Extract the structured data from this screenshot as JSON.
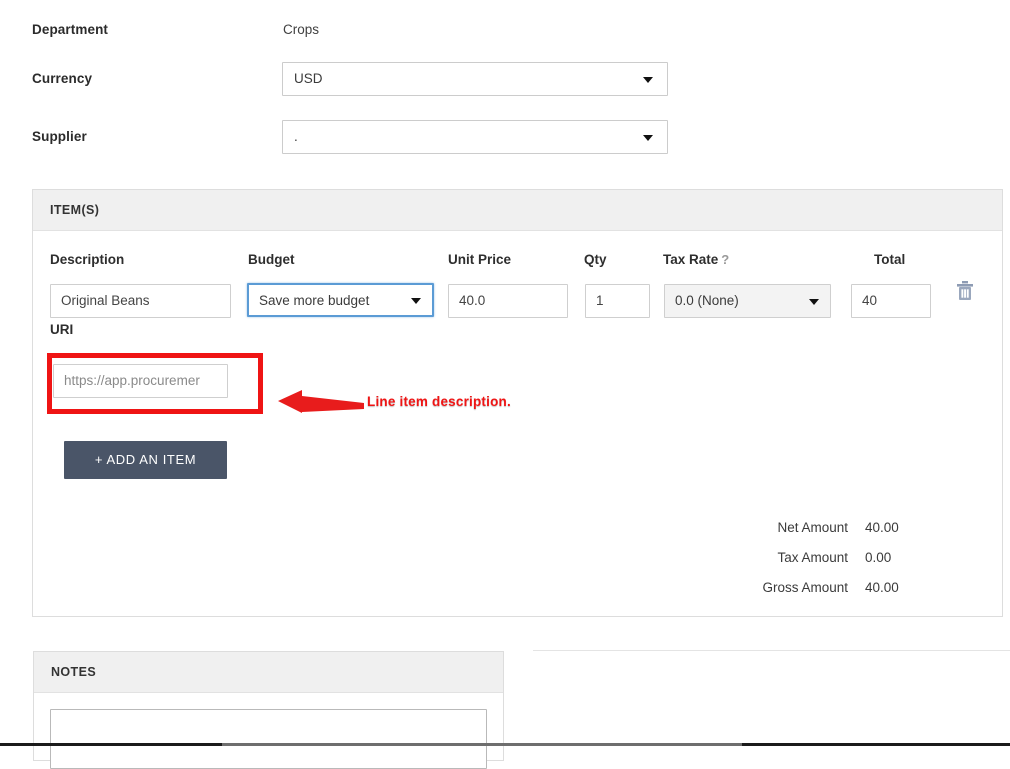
{
  "form": {
    "rows": [
      {
        "label": "Department",
        "value": "Crops",
        "type": "text"
      },
      {
        "label": "Currency",
        "value": "USD",
        "type": "select"
      },
      {
        "label": "Supplier",
        "value": ".",
        "type": "select"
      }
    ]
  },
  "items_panel": {
    "title": "ITEM(S)",
    "columns": {
      "description": "Description",
      "budget": "Budget",
      "unit_price": "Unit Price",
      "qty": "Qty",
      "tax_rate": "Tax Rate",
      "tax_rate_help": "?",
      "total": "Total",
      "uri": "URI"
    },
    "row": {
      "description": "Original Beans",
      "budget": "Save more budget",
      "unit_price": "40.0",
      "qty": "1",
      "tax_rate": "0.0 (None)",
      "total": "40",
      "uri_placeholder": "https://app.procuremer",
      "delete_icon": "trash-icon"
    },
    "add_item_label": "+ ADD AN ITEM",
    "totals": [
      {
        "label": "Net Amount",
        "value": "40.00"
      },
      {
        "label": "Tax Amount",
        "value": "0.00"
      },
      {
        "label": "Gross Amount",
        "value": "40.00"
      }
    ]
  },
  "annotation": {
    "text": "Line item description.",
    "color": "#ef1414",
    "arrow_icon": "left-arrow-icon"
  },
  "notes_panel": {
    "title": "NOTES",
    "textarea_value": ""
  },
  "colors": {
    "accent_button": "#4a5568",
    "focus_ring": "#5b9bd5",
    "panel_header_bg": "#f0f0f0",
    "annotation_red": "#ef1414"
  }
}
